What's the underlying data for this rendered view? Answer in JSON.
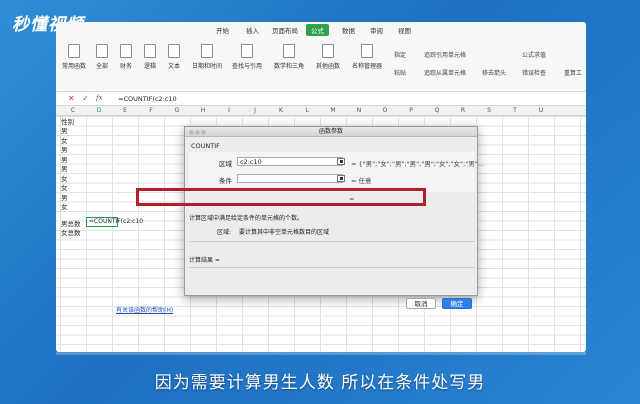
{
  "watermark": "秒懂视频",
  "tabs": [
    "开始",
    "插入",
    "页面布局",
    "公式",
    "数据",
    "审阅",
    "视图"
  ],
  "active_tab": "公式",
  "ribbon": {
    "buttons": [
      "常用函数",
      "全部",
      "财务",
      "逻辑",
      "文本",
      "日期和时间",
      "查找与引用",
      "数学和三角",
      "其他函数",
      "名称管理器"
    ],
    "side": [
      "指定",
      "粘贴",
      "追踪引用单元格",
      "追踪从属单元格",
      "移去箭头",
      "公式求值",
      "错误检查",
      "重算工"
    ]
  },
  "formula_bar": {
    "cancel": "✕",
    "confirm": "✓",
    "fx": "fx",
    "text": "=COUNTIF(c2:c10"
  },
  "columns": [
    "C",
    "D",
    "E",
    "F",
    "G",
    "H",
    "I",
    "J",
    "K",
    "L",
    "M",
    "N",
    "O",
    "P",
    "Q",
    "R",
    "S",
    "T",
    "U"
  ],
  "cells": {
    "c1": "性别",
    "c2": "男",
    "c3": "女",
    "c4": "男",
    "c5": "男",
    "c6": "男",
    "c7": "女",
    "c8": "女",
    "c9": "男",
    "c10": "女",
    "c12": "男总数",
    "c13": "女总数",
    "d12": "=COUNTIF(c2:c10"
  },
  "dialog": {
    "title": "函数参数",
    "function": "COUNTIF",
    "range_label": "区域",
    "range_value": "c2:c10",
    "range_result": "= {\"男\";\"女\";\"男\";\"男\";\"男\";\"女\";\"女\";\"男\"…",
    "criteria_label": "条件",
    "criteria_value": "",
    "criteria_result": "= 任意",
    "result_dash": "=",
    "description": "计算区域中满足给定条件的单元格的个数。",
    "arg_label": "区域:",
    "arg_desc": "要计算其中非空单元格数目的区域",
    "calc_result_label": "计算结果 =",
    "help_link": "有关该函数的帮助(H)",
    "cancel": "取消",
    "ok": "确定"
  },
  "subtitle": "因为需要计算男生人数 所以在条件处写男"
}
